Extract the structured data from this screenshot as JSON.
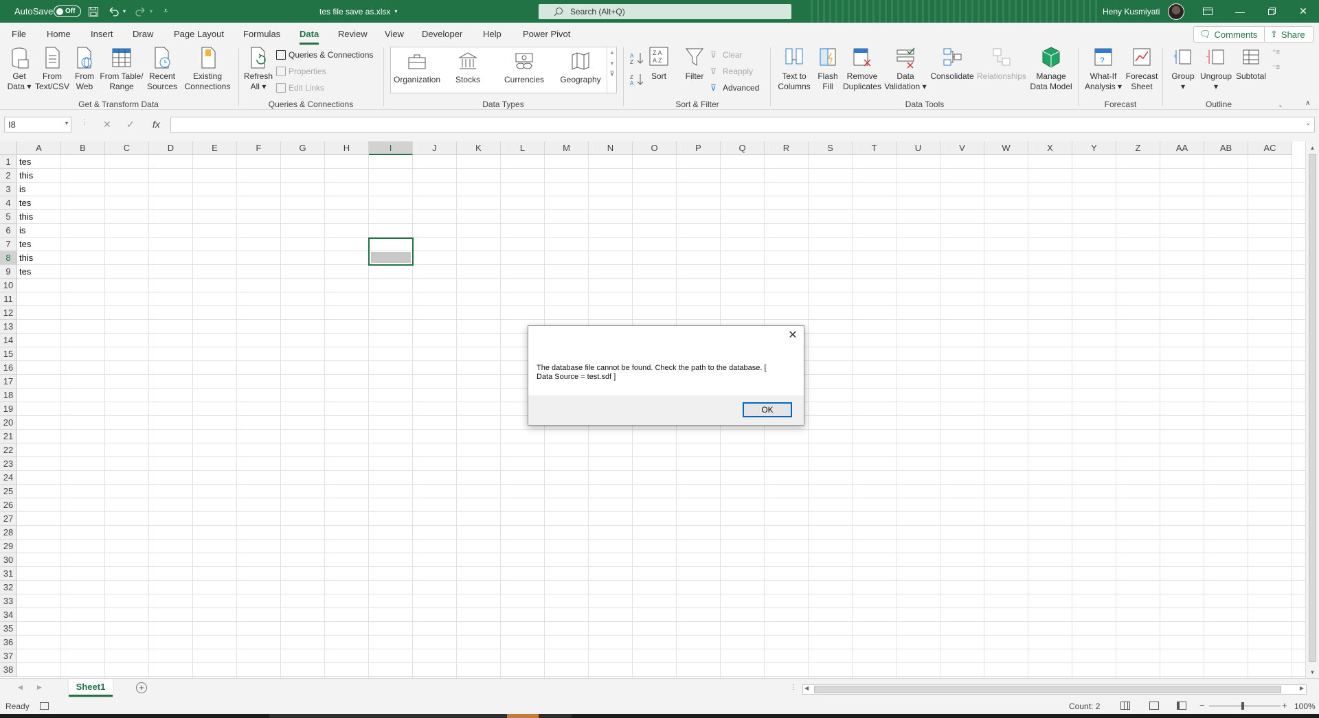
{
  "titlebar": {
    "autosave_label": "AutoSave",
    "autosave_state": "Off",
    "filename": "tes file save as.xlsx",
    "search_placeholder": "Search (Alt+Q)",
    "username": "Heny Kusmiyati",
    "accent": "#217346"
  },
  "menu": {
    "tabs": [
      "File",
      "Home",
      "Insert",
      "Draw",
      "Page Layout",
      "Formulas",
      "Data",
      "Review",
      "View",
      "Developer",
      "Help",
      "Power Pivot"
    ],
    "active": "Data",
    "comments": "Comments",
    "share": "Share"
  },
  "ribbon": {
    "get_data": [
      "Get",
      "Data"
    ],
    "from_text": [
      "From",
      "Text/CSV"
    ],
    "from_web": [
      "From",
      "Web"
    ],
    "from_table": [
      "From Table/",
      "Range"
    ],
    "recent_sources": [
      "Recent",
      "Sources"
    ],
    "existing_connections": [
      "Existing",
      "Connections"
    ],
    "group_get_transform": "Get & Transform Data",
    "refresh_all": [
      "Refresh",
      "All"
    ],
    "queries_connections": "Queries & Connections",
    "properties": "Properties",
    "edit_links": "Edit Links",
    "group_queries": "Queries & Connections",
    "data_types": [
      "Organization",
      "Stocks",
      "Currencies",
      "Geography"
    ],
    "group_data_types": "Data Types",
    "sort": "Sort",
    "filter": "Filter",
    "clear": "Clear",
    "reapply": "Reapply",
    "advanced": "Advanced",
    "group_sort_filter": "Sort & Filter",
    "text_to_columns": [
      "Text to",
      "Columns"
    ],
    "flash_fill": [
      "Flash",
      "Fill"
    ],
    "remove_duplicates": [
      "Remove",
      "Duplicates"
    ],
    "data_validation": [
      "Data",
      "Validation"
    ],
    "consolidate": "Consolidate",
    "relationships": "Relationships",
    "manage_data_model": [
      "Manage",
      "Data Model"
    ],
    "group_data_tools": "Data Tools",
    "what_if": [
      "What-If",
      "Analysis"
    ],
    "forecast_sheet": [
      "Forecast",
      "Sheet"
    ],
    "group_forecast": "Forecast",
    "group_btn": "Group",
    "ungroup": "Ungroup",
    "subtotal": "Subtotal",
    "group_outline": "Outline"
  },
  "formula_bar": {
    "name_box": "I8",
    "cancel_icon": "✕",
    "enter_icon": "✓",
    "fx": "fx",
    "formula": ""
  },
  "grid": {
    "columns": [
      "A",
      "B",
      "C",
      "D",
      "E",
      "F",
      "G",
      "H",
      "I",
      "J",
      "K",
      "L",
      "M",
      "N",
      "O",
      "P",
      "Q",
      "R",
      "S",
      "T",
      "U",
      "V",
      "W",
      "X",
      "Y",
      "Z",
      "AA",
      "AB",
      "AC"
    ],
    "rows": [
      "1",
      "2",
      "3",
      "4",
      "5",
      "6",
      "7",
      "8",
      "9",
      "10",
      "11",
      "12",
      "13",
      "14",
      "15",
      "16",
      "17",
      "18",
      "19",
      "20",
      "21",
      "22",
      "23",
      "24",
      "25",
      "26",
      "27",
      "28",
      "29",
      "30",
      "31",
      "32",
      "33",
      "34",
      "35",
      "36",
      "37",
      "38"
    ],
    "col_a_values": [
      "tes",
      "this",
      "is",
      "tes",
      "this",
      "is",
      "tes",
      "this",
      "tes"
    ],
    "selected_cell": "I8"
  },
  "sheets": {
    "tabs": [
      "Sheet1"
    ],
    "add_icon": "+"
  },
  "statusbar": {
    "ready": "Ready",
    "count": "Count: 2",
    "zoom": "100%"
  },
  "dialog": {
    "message_line1": "The database file cannot be found. Check the path to the database. [",
    "message_line2": "Data Source = test.sdf ]",
    "ok_label": "OK",
    "close_icon": "✕"
  }
}
